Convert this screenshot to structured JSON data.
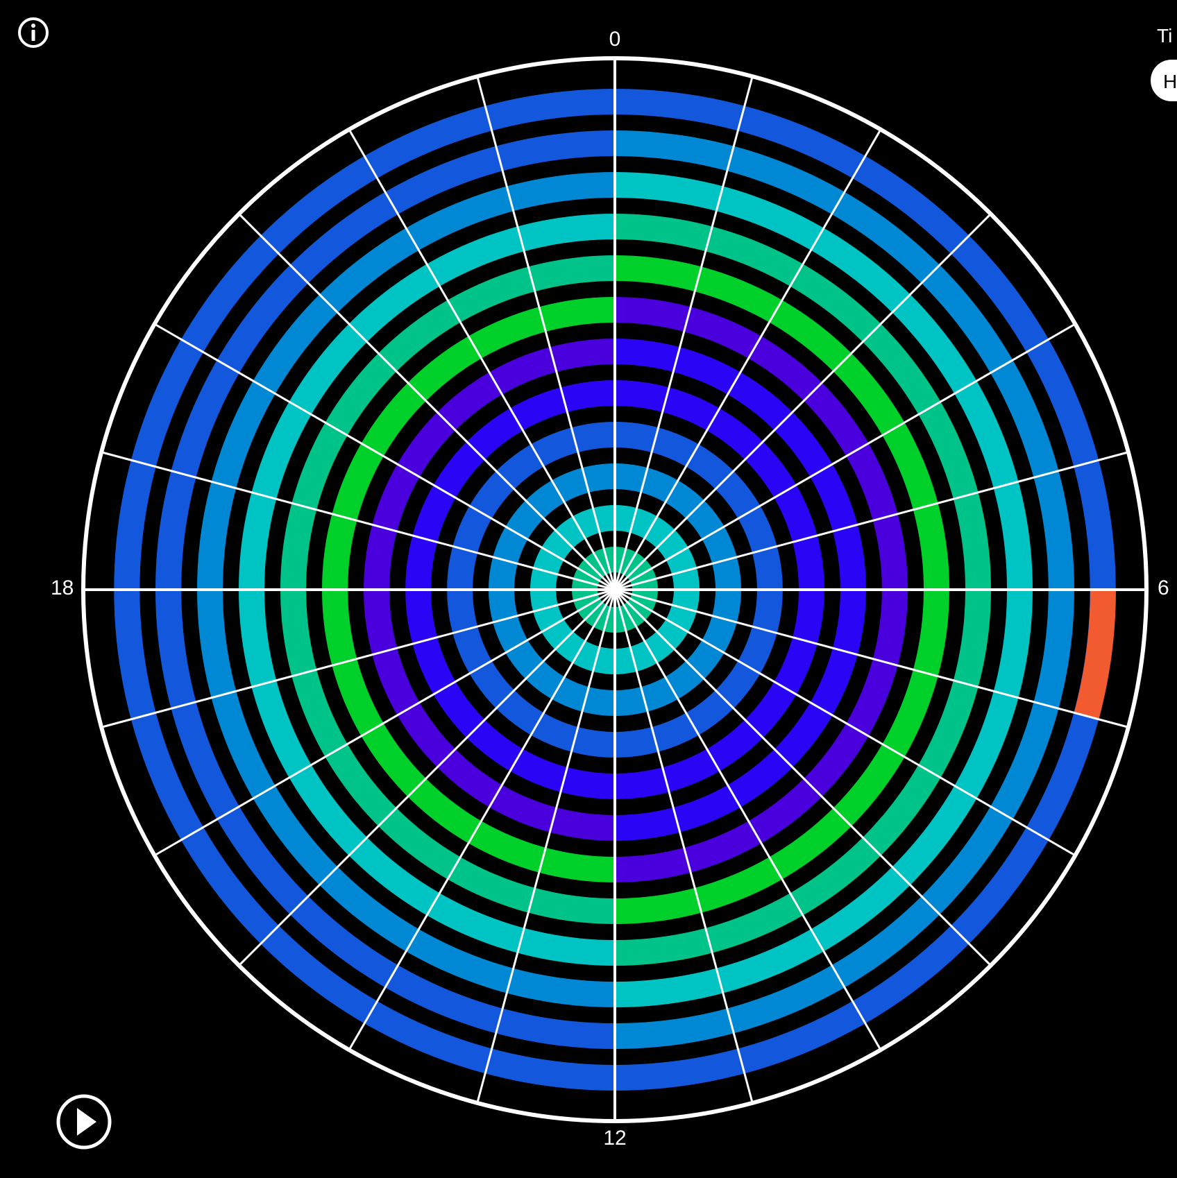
{
  "axis_labels": {
    "top": "0",
    "right": "6",
    "bottom": "12",
    "left": "18"
  },
  "corner_control": {
    "label": "Ti",
    "pill_text": "H"
  },
  "controls": {
    "info_icon": "info-icon",
    "play_icon": "play-icon"
  },
  "colors": {
    "background": "#000000",
    "grid": "#ffffff",
    "ring_palette": {
      "teal_green": "#00c389",
      "cyan": "#00c4c4",
      "sky_blue": "#0088d4",
      "royal_blue": "#1358dc",
      "bright_blue": "#2a05f5",
      "violet": "#4a00dc",
      "green": "#00d02a",
      "orange_red": "#f25a2f"
    }
  },
  "chart_data": {
    "type": "heatmap",
    "projection": "polar",
    "angular_sectors": 24,
    "angular_ticks": [
      "0",
      "6",
      "12",
      "18"
    ],
    "rings": 12,
    "ring_colors_inner_to_outer": [
      [
        "teal_green",
        "teal_green"
      ],
      [
        "cyan",
        "cyan"
      ],
      [
        "sky_blue",
        "sky_blue"
      ],
      [
        "royal_blue",
        "royal_blue"
      ],
      [
        "bright_blue",
        "bright_blue"
      ],
      [
        "violet",
        "bright_blue"
      ],
      [
        "green",
        "violet"
      ],
      [
        "teal_green",
        "green"
      ],
      [
        "cyan",
        "teal_green"
      ],
      [
        "sky_blue",
        "cyan"
      ],
      [
        "royal_blue",
        "sky_blue"
      ],
      [
        "royal_blue",
        "royal_blue"
      ]
    ],
    "highlight": {
      "ring": 12,
      "sector": 6,
      "color": "orange_red"
    },
    "grid": true
  }
}
